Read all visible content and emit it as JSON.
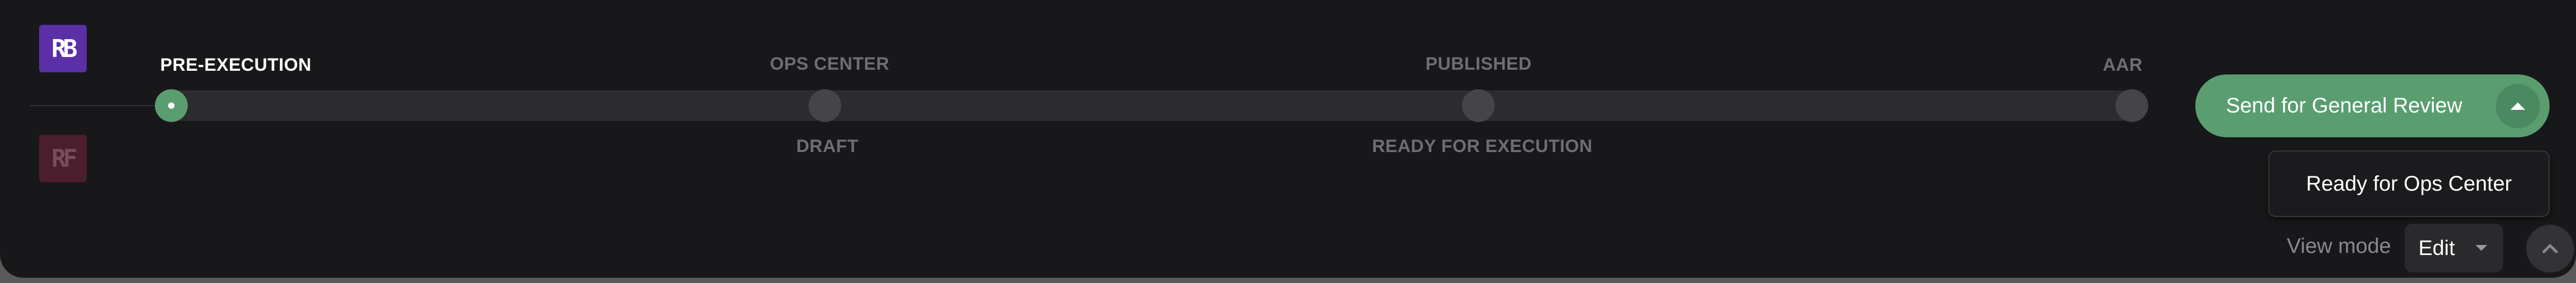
{
  "workspaces": {
    "primary_initials": "RB",
    "secondary_initials": "RF"
  },
  "timeline": {
    "steps": [
      {
        "label": "PRE-EXECUTION",
        "state": "current"
      },
      {
        "label": "DRAFT",
        "state": "upcoming"
      },
      {
        "label": "OPS CENTER",
        "state": "upcoming"
      },
      {
        "label": "READY FOR EXECUTION",
        "state": "upcoming"
      },
      {
        "label": "PUBLISHED",
        "state": "upcoming"
      },
      {
        "label": "AAR",
        "state": "upcoming"
      }
    ]
  },
  "actions": {
    "primary_label": "Send for General Review",
    "menu_items": [
      "Ready for Ops Center"
    ]
  },
  "view_mode": {
    "label": "View mode",
    "selected": "Edit"
  },
  "icons": {
    "caret_up": "chevron-up-icon",
    "caret_down": "chevron-down-icon",
    "collapse": "chevron-up-icon"
  },
  "colors": {
    "accent_green": "#5a9e70",
    "background": "#18181a",
    "workspace_primary": "#5b2fa6",
    "workspace_secondary": "#4a1e2c"
  }
}
